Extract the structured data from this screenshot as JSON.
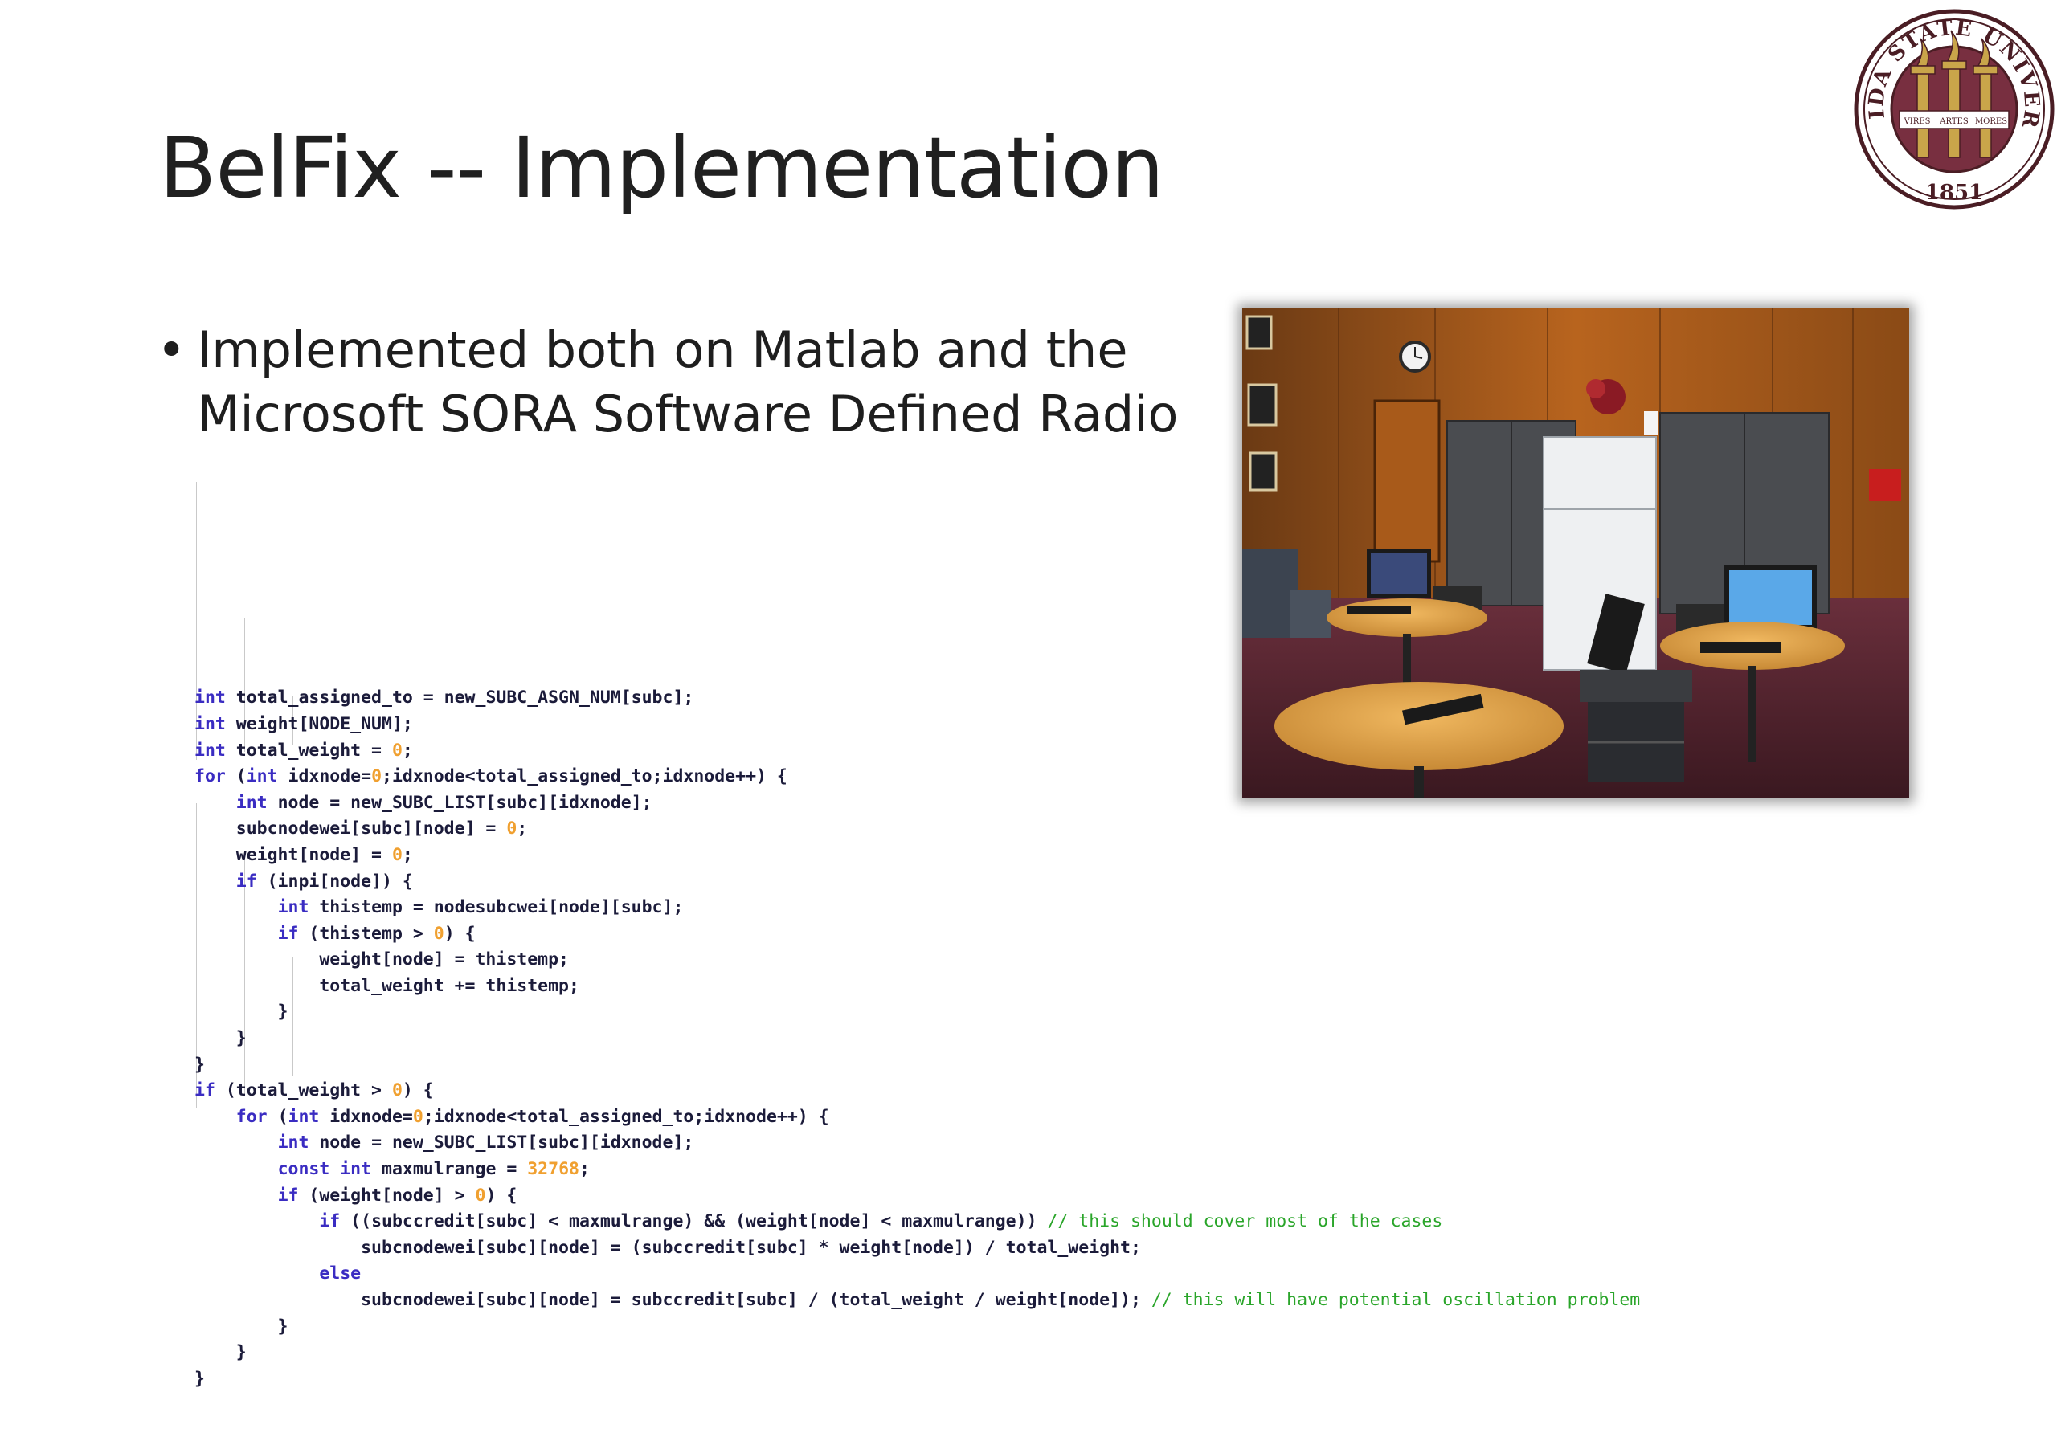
{
  "slide": {
    "title": "BelFix -- Implementation",
    "bullet_marker": "•",
    "bullet_line1": "Implemented both on Matlab and the",
    "bullet_line2": "Microsoft SORA Software Defined Radio"
  },
  "seal": {
    "text": "FLORIDA STATE UNIVERSITY",
    "year": "1851",
    "words": [
      "VIRES",
      "ARTES",
      "MORES"
    ]
  },
  "photo": {
    "description": "lab room with two desks, computers, monitors, refrigerator and cabinets"
  },
  "colors": {
    "keyword": "#3a2cc2",
    "number": "#f0a030",
    "comment": "#2aa52a",
    "seal_red": "#782f40",
    "seal_gold": "#c9a54a"
  }
}
